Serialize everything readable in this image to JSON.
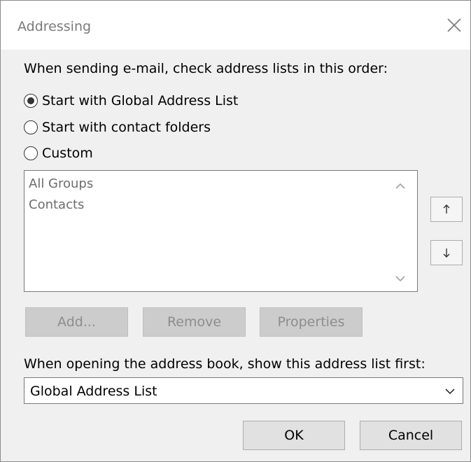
{
  "window": {
    "title": "Addressing"
  },
  "sending": {
    "label": "When sending e-mail, check address lists in this order:",
    "options": [
      {
        "label": "Start with Global Address List",
        "selected": true
      },
      {
        "label": "Start with contact folders",
        "selected": false
      },
      {
        "label": "Custom",
        "selected": false
      }
    ]
  },
  "address_lists": {
    "items": [
      "All Groups",
      "Contacts"
    ]
  },
  "buttons": {
    "add": "Add...",
    "remove": "Remove",
    "properties": "Properties",
    "ok": "OK",
    "cancel": "Cancel"
  },
  "opening": {
    "label": "When opening the address book, show this address list first:",
    "selected_value": "Global Address List"
  },
  "icons": {
    "close": "close-icon",
    "move_up": "move-up-icon",
    "move_down": "move-down-icon",
    "scroll_up": "chevron-up-icon",
    "scroll_down": "chevron-down-icon",
    "dropdown": "chevron-down-icon"
  },
  "colors": {
    "dialog_background": "#f0f0f0",
    "title_text": "#7a7a7a",
    "disabled_button": "#cccccc",
    "list_text": "#6d6d6d"
  }
}
